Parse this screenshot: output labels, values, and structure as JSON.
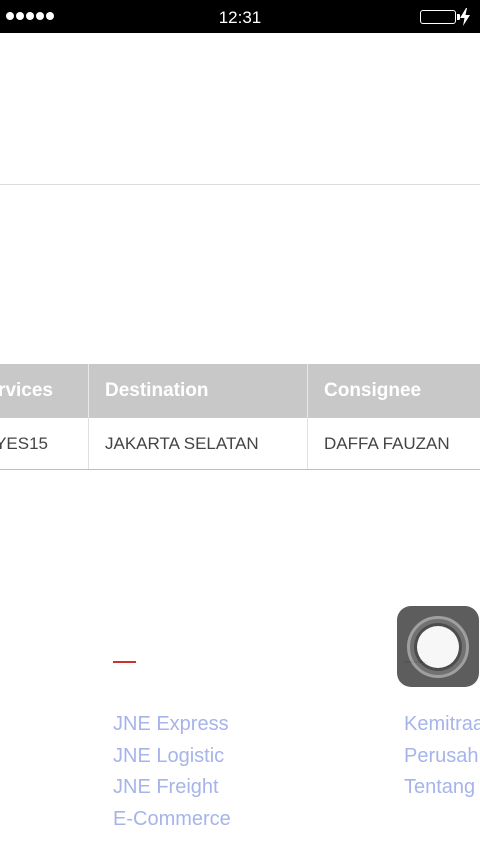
{
  "status_bar": {
    "time": "12:31",
    "icons": [
      "signal-dots-icon",
      "battery-icon",
      "charging-bolt-icon"
    ]
  },
  "table": {
    "headers": [
      "ervices",
      "Destination",
      "Consignee"
    ],
    "rows": [
      [
        "YES15",
        "JAKARTA SELATAN",
        "DAFFA FAUZAN"
      ]
    ]
  },
  "footer": {
    "accent_color": "#d32f2f",
    "link_color": "#a6b4ea",
    "left_links": [
      "JNE Express",
      "JNE Logistic",
      "JNE Freight",
      "E-Commerce"
    ],
    "right_links": [
      "Kemitraa",
      "Perusah",
      "Tentang"
    ]
  },
  "assistive_touch": {
    "icon": "assistive-touch-icon"
  }
}
